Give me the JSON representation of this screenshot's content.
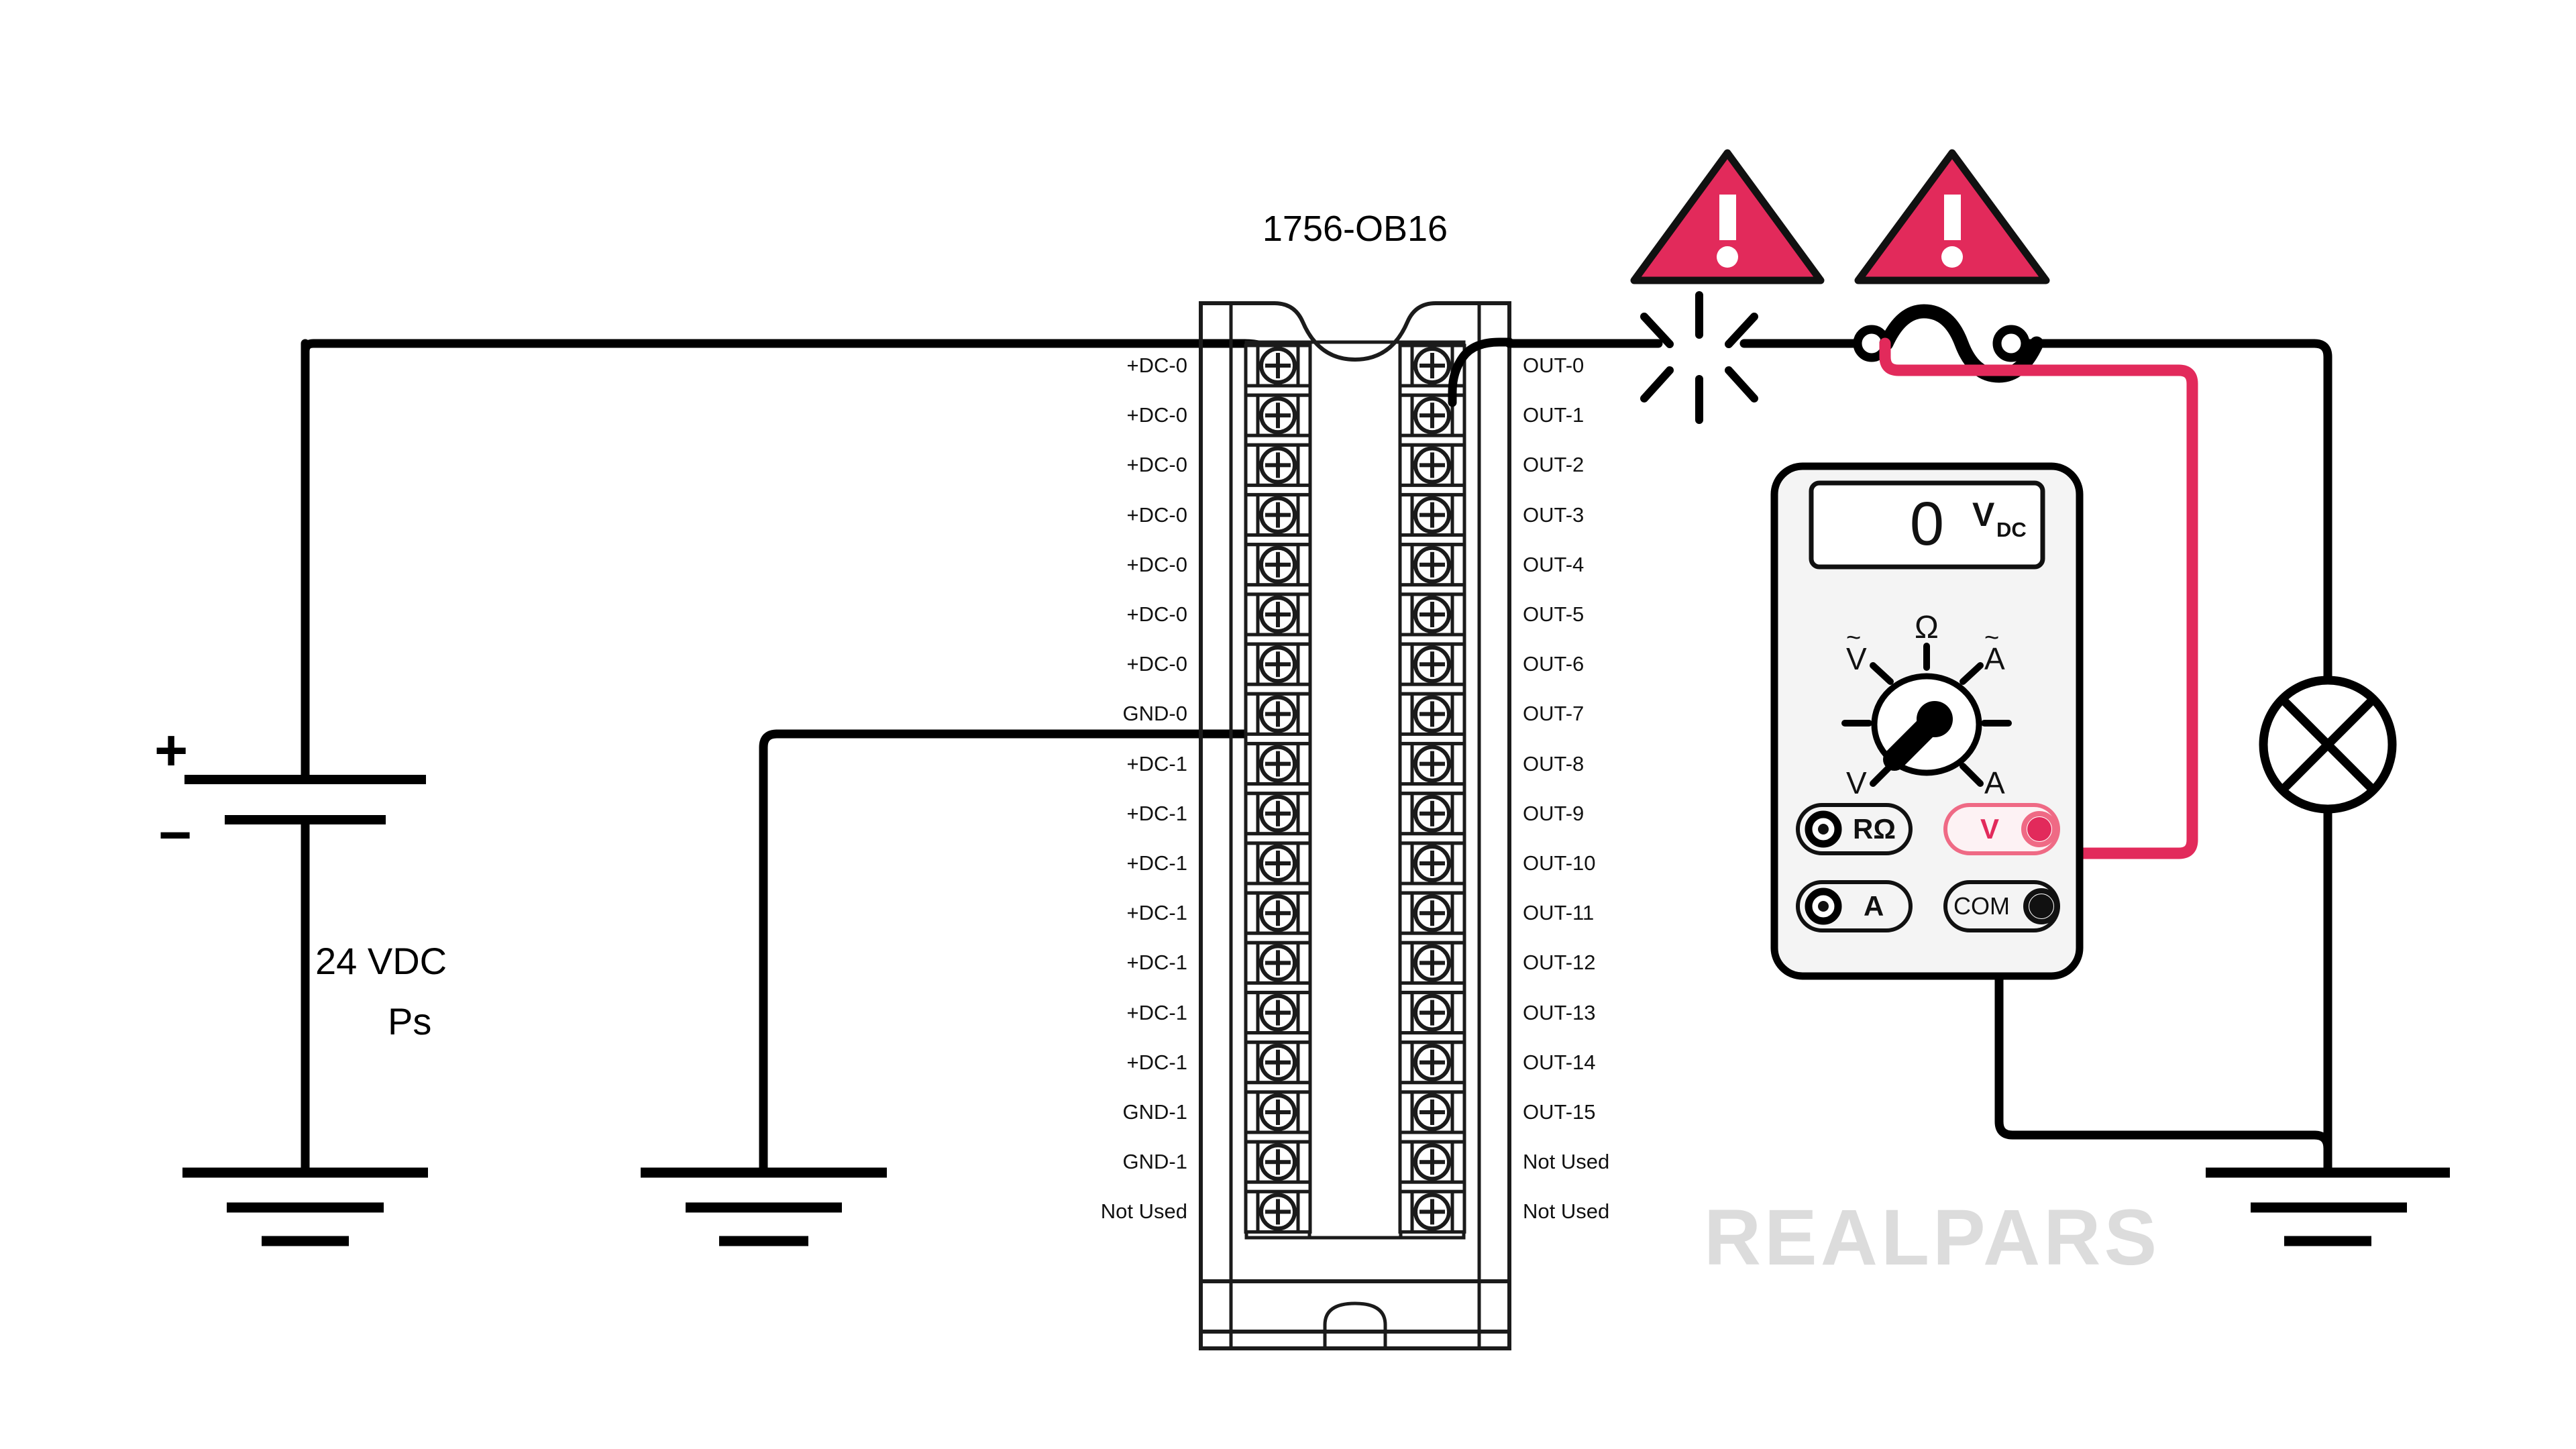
{
  "diagram": {
    "module_title": "1756-OB16",
    "watermark": "REALPARS",
    "power_supply": {
      "label_line1": "24 VDC",
      "label_line2": "Ps",
      "plus_symbol": "+",
      "minus_symbol": "−"
    },
    "terminal_block": {
      "left_labels": [
        "+DC-0",
        "+DC-0",
        "+DC-0",
        "+DC-0",
        "+DC-0",
        "+DC-0",
        "+DC-0",
        "GND-0",
        "+DC-1",
        "+DC-1",
        "+DC-1",
        "+DC-1",
        "+DC-1",
        "+DC-1",
        "+DC-1",
        "GND-1",
        "GND-1",
        "Not Used"
      ],
      "right_labels": [
        "OUT-0",
        "OUT-1",
        "OUT-2",
        "OUT-3",
        "OUT-4",
        "OUT-5",
        "OUT-6",
        "OUT-7",
        "OUT-8",
        "OUT-9",
        "OUT-10",
        "OUT-11",
        "OUT-12",
        "OUT-13",
        "OUT-14",
        "OUT-15",
        "Not Used",
        "Not Used"
      ]
    },
    "multimeter": {
      "reading": "0",
      "unit_main": "V",
      "unit_sub": "DC",
      "dial_labels": {
        "ac_volts": "V",
        "ac_volts_tilde": "~",
        "ohms": "Ω",
        "ac_amps": "A",
        "ac_amps_tilde": "~",
        "dc_volts": "V",
        "dc_amps": "A"
      },
      "jacks": [
        {
          "label": "RΩ",
          "side": "left",
          "color": "#111111"
        },
        {
          "label": "A",
          "side": "left",
          "color": "#111111"
        },
        {
          "label": "V",
          "side": "right",
          "color": "#E22A5B"
        },
        {
          "label": "COM",
          "side": "right",
          "color": "#111111"
        }
      ]
    },
    "warnings": [
      {
        "glyph": "!",
        "name": "warning-triangle-spark"
      },
      {
        "glyph": "!",
        "name": "warning-triangle-broken-wire"
      }
    ],
    "colors": {
      "accent_pink": "#E22A5B",
      "wire_black": "#000000",
      "watermark_gray": "#DCDCDC",
      "module_body": "#FFFFFF"
    }
  }
}
